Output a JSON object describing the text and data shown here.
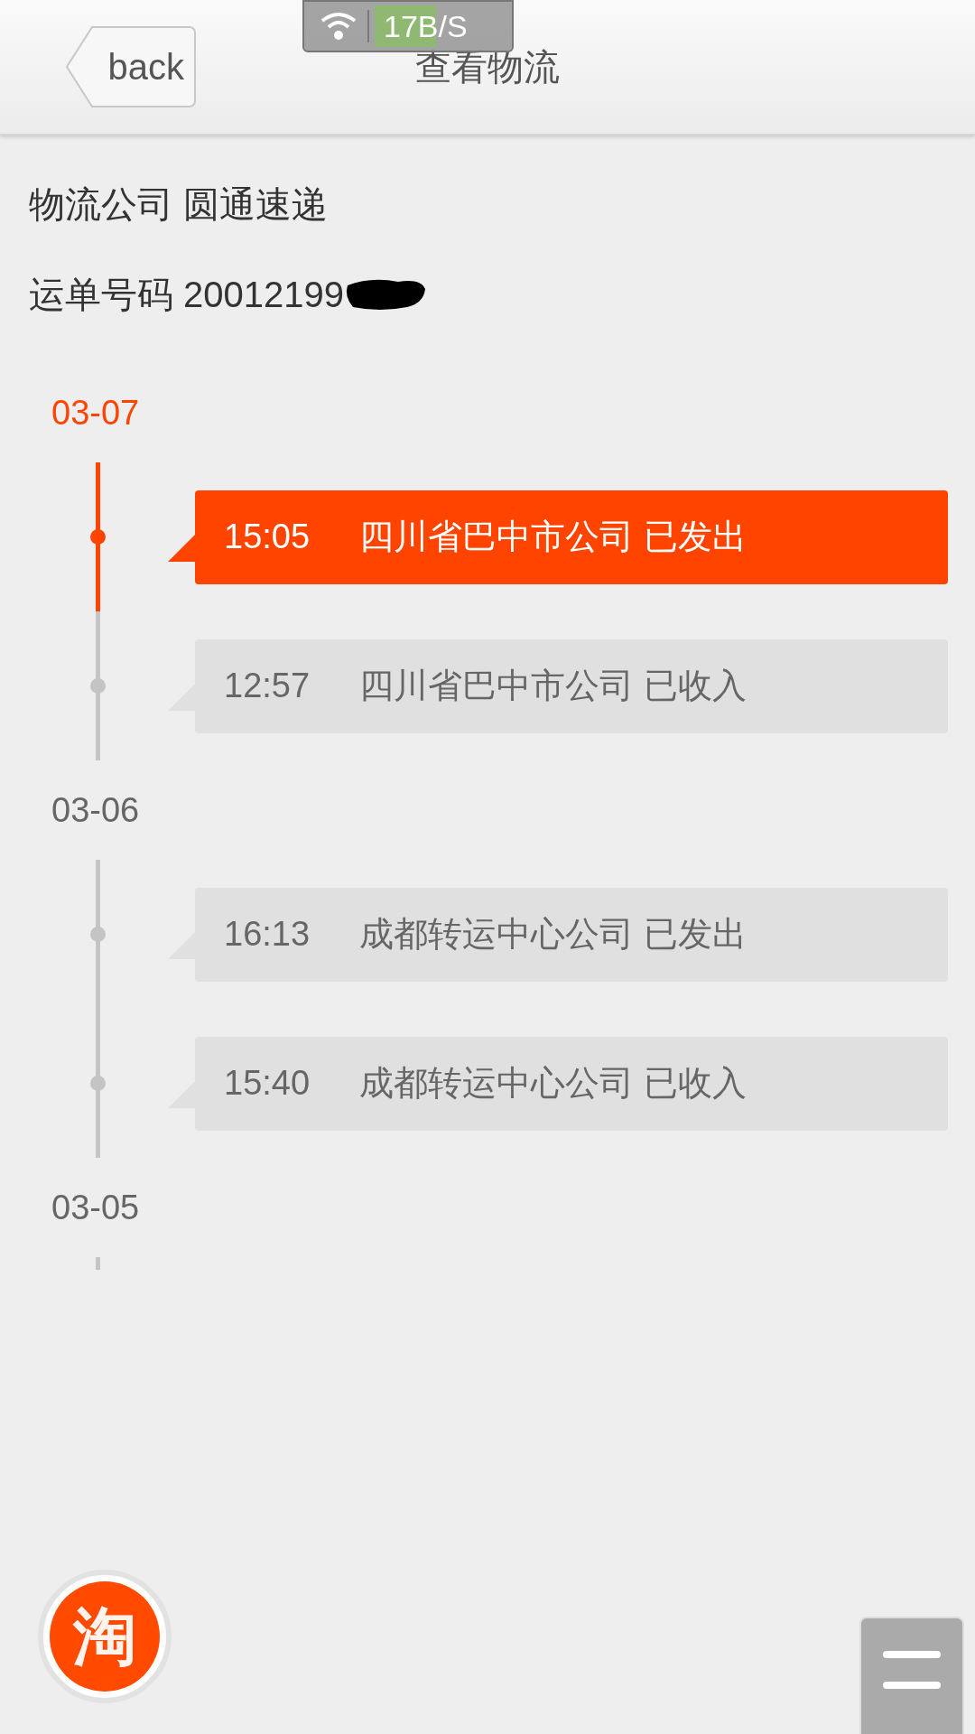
{
  "status_overlay": {
    "speed": "17B/S"
  },
  "header": {
    "back": "back",
    "title": "查看物流"
  },
  "info": [
    "物流公司 圆通速递",
    "运单号码 20012199"
  ],
  "days": [
    {
      "date": "03-07",
      "latest": true,
      "entries": [
        {
          "time": "15:05",
          "text": "四川省巴中市公司 已发出",
          "latest": true
        },
        {
          "time": "12:57",
          "text": "四川省巴中市公司 已收入",
          "latest": false
        }
      ]
    },
    {
      "date": "03-06",
      "latest": false,
      "entries": [
        {
          "time": "16:13",
          "text": "成都转运中心公司 已发出",
          "latest": false
        },
        {
          "time": "15:40",
          "text": "成都转运中心公司 已收入",
          "latest": false
        }
      ]
    },
    {
      "date": "03-05",
      "latest": false
    }
  ],
  "app_badge": {
    "char": "淘"
  }
}
